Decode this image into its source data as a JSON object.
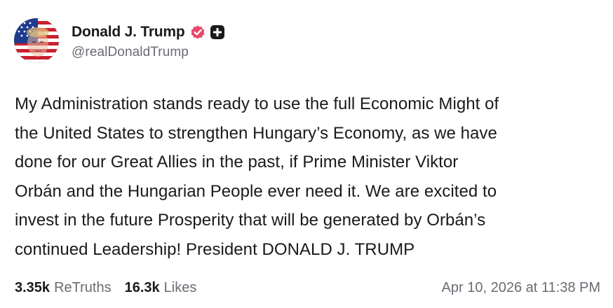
{
  "post": {
    "author": {
      "display_name": "Donald J. Trump",
      "handle": "@realDonaldTrump",
      "avatar": "flag-portrait-avatar",
      "verified_icon": "verified-badge-icon",
      "badge_icon": "plus-badge-icon"
    },
    "text": "My Administration stands ready to use the full Economic Might of\nthe United States to strengthen Hungary’s Economy, as we have\ndone for our Great Allies in the past, if Prime Minister Viktor\nOrbán and the Hungarian People ever need it. We are excited to\ninvest in the future Prosperity that will be generated by Orbán’s\ncontinued Leadership! President DONALD J. TRUMP",
    "stats": {
      "retruths_count": "3.35k",
      "retruths_label": "ReTruths",
      "likes_count": "16.3k",
      "likes_label": "Likes"
    },
    "timestamp": "Apr 10, 2026 at 11:38 PM"
  },
  "colors": {
    "text_primary": "#1a1a1a",
    "text_secondary": "#6b6b73",
    "verified_badge": "#e8486b",
    "background": "#ffffff"
  }
}
